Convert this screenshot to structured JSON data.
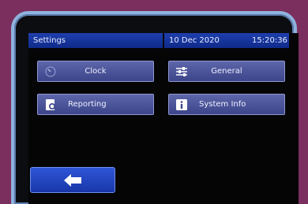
{
  "status_bar": {
    "title": "Settings",
    "date": "10 Dec 2020",
    "time": "15:20:36"
  },
  "menu": {
    "clock": {
      "label": "Clock",
      "icon": "clock-icon"
    },
    "general": {
      "label": "General",
      "icon": "sliders-icon"
    },
    "reporting": {
      "label": "Reporting",
      "icon": "report-icon"
    },
    "system_info": {
      "label": "System Info",
      "icon": "info-icon"
    }
  },
  "back": {
    "icon": "arrow-left-icon"
  },
  "colors": {
    "status_bar": "#1e3fae",
    "tile": "#4b55a0",
    "back_button": "#2447c4",
    "background": "#7a2f5e"
  }
}
